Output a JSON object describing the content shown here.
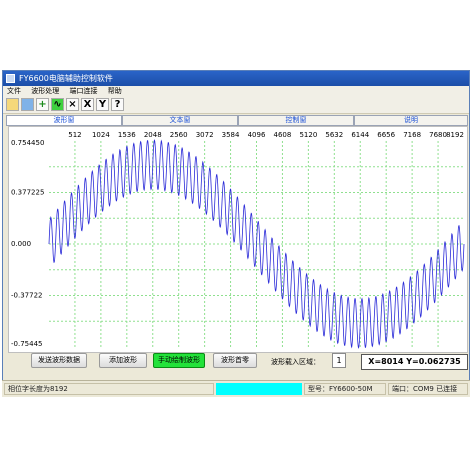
{
  "window": {
    "title": "FY6600电脑辅助控制软件"
  },
  "menu": [
    "文件",
    "波形处理",
    "端口连接",
    "帮助"
  ],
  "toolbar": {
    "icons": [
      "open-icon",
      "save-icon",
      "add-icon",
      "wave-icon",
      "formula-icon"
    ],
    "x_label": "X",
    "y_label": "Y",
    "help_label": "?"
  },
  "tabs": [
    {
      "label": "波形窗",
      "active": true
    },
    {
      "label": "文本窗",
      "active": false
    },
    {
      "label": "控制窗",
      "active": false
    },
    {
      "label": "说明",
      "active": false
    }
  ],
  "chart_data": {
    "type": "line",
    "x_ticks": [
      "512",
      "1024",
      "1536",
      "2048",
      "2560",
      "3072",
      "3584",
      "4096",
      "4608",
      "5120",
      "5632",
      "6144",
      "6656",
      "7168",
      "7680",
      "8192"
    ],
    "y_ticks": [
      "0.754450",
      "0.377225",
      "0.000",
      "-0.37722",
      "-0.75445"
    ],
    "xlim": [
      0,
      8192
    ],
    "ylim": [
      -0.75445,
      0.75445
    ],
    "grid": true,
    "series": [
      {
        "description": "sine carrier amplitude 0.58 period 8192 plus ripple amplitude 0.18 period ~136 samples",
        "base_amplitude": 0.58,
        "ripple_amplitude": 0.18,
        "ripple_cycles": 60,
        "color": "#2b2bd8"
      }
    ]
  },
  "buttons": {
    "send": "发送波形数据",
    "add": "添加波形",
    "manual": "手动绘制波形",
    "zero": "波形首零"
  },
  "region_label": "波形载入区域：",
  "region_value": "1",
  "coord_readout": "X=8014 Y=0.062735",
  "status": {
    "length": "相位字长度为8192",
    "model": "型号：FY6600-50M",
    "port": "端口：COM9 已连接"
  }
}
